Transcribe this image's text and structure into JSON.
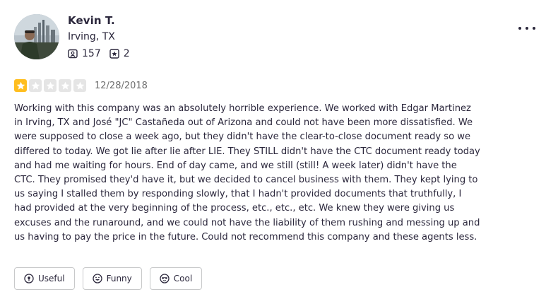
{
  "reviewer": {
    "name": "Kevin T.",
    "location": "Irving, TX",
    "stats": {
      "reviews_count": "157",
      "photos_count": "2"
    }
  },
  "review": {
    "rating": 1,
    "max_rating": 5,
    "date": "12/28/2018",
    "text": "Working with this company was an absolutely horrible experience. We worked with Edgar Martinez in Irving, TX and José \"JC\" Castañeda out of Arizona and could not have been more dissatisfied. We were supposed to close a week ago, but they didn't have the clear-to-close document ready so we differed to today. We got lie after lie after LIE. They STILL didn't have the CTC document ready today and had me waiting for hours. End of day came, and we still (still! A week later) didn't have the CTC. They promised they'd have it, but we decided to cancel business with them. They kept lying to us saying I stalled them by responding slowly, that I hadn't provided documents that truthfully, I had provided at the very beginning of the process, etc., etc., etc. We knew they were giving us excuses and the runaround, and we could not have the liability of them rushing and messing up and us having to pay the price in the future. Could not recommend this company and these agents less."
  },
  "reactions": {
    "useful_label": "Useful",
    "funny_label": "Funny",
    "cool_label": "Cool"
  },
  "colors": {
    "star_filled": "#ffbe1f",
    "star_empty": "#e5e5e5",
    "text": "#2b273c",
    "muted": "#6e6e6e",
    "border": "#c8c9ca"
  },
  "icons": {
    "reviews": "speech-bubble-icon",
    "photos": "star-badge-icon",
    "more": "ellipsis-icon",
    "useful": "lightbulb-icon",
    "funny": "smile-icon",
    "cool": "sunglasses-icon"
  }
}
